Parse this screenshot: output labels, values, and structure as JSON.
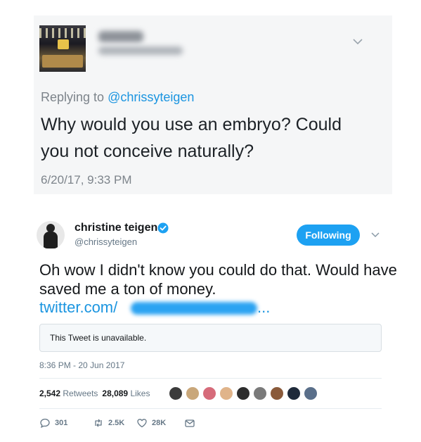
{
  "quoted_tweet": {
    "replying_prefix": "Replying to ",
    "replying_to": "@chrissyteigen",
    "text": "Why would you use an embryo?  Could you not conceive naturally?",
    "timestamp": "6/20/17, 9:33 PM"
  },
  "tweet": {
    "author_name": "christine teigen",
    "author_handle": "@chrissyteigen",
    "follow_label": "Following",
    "text": "Oh wow I didn't know you could do that. Would have saved me a ton of money.",
    "link_start": "twitter.com/",
    "link_end": "...",
    "unavailable_text": "This Tweet is unavailable.",
    "timestamp": "8:36 PM - 20 Jun 2017",
    "retweets_count": "2,542",
    "retweets_label": "Retweets",
    "likes_count": "28,089",
    "likes_label": "Likes",
    "reply_count": "301",
    "retweet_count_short": "2.5K",
    "like_count_short": "28K"
  },
  "colors": {
    "accent": "#1da1f2",
    "link": "#1b95e0",
    "muted": "#657786"
  },
  "likers": [
    {
      "color": "#3b3b3b"
    },
    {
      "color": "#c9a77a"
    },
    {
      "color": "#d66b7a"
    },
    {
      "color": "#e0b48a"
    },
    {
      "color": "#2d2d2d"
    },
    {
      "color": "#7a7a7a"
    },
    {
      "color": "#8a5a3a"
    },
    {
      "color": "#1f2a3a"
    },
    {
      "color": "#5a6f8a"
    }
  ]
}
